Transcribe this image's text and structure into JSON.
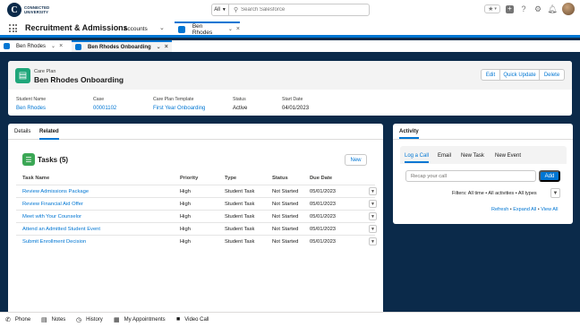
{
  "brand": {
    "logo_letter": "C",
    "name_line1": "CONNECTED",
    "name_line2": "UNIVERSITY"
  },
  "search": {
    "scope": "All",
    "placeholder": "Search Salesforce"
  },
  "app": {
    "name": "Recruitment & Admissions",
    "nav_item": "Accounts",
    "active_tab": "Ben Rhodes"
  },
  "subtabs": [
    {
      "label": "Ben Rhodes"
    },
    {
      "label": "Ben Rhodes Onboarding"
    }
  ],
  "record": {
    "type": "Care Plan",
    "name": "Ben Rhodes Onboarding",
    "buttons": {
      "edit": "Edit",
      "quick_update": "Quick Update",
      "delete": "Delete"
    },
    "fields": [
      {
        "label": "Student Name",
        "value": "Ben Rhodes"
      },
      {
        "label": "Case",
        "value": "00001102"
      },
      {
        "label": "Care Plan Template",
        "value": "First Year Onboarding"
      },
      {
        "label": "Status",
        "value": "Active"
      },
      {
        "label": "Start Date",
        "value": "04/01/2023"
      }
    ]
  },
  "main": {
    "tabs": [
      "Details",
      "Related"
    ],
    "tasks": {
      "title": "Tasks (5)",
      "new_button": "New",
      "columns": [
        "Task Name",
        "Priority",
        "Type",
        "Status",
        "Due Date"
      ],
      "rows": [
        {
          "name": "Review Admissions Package",
          "priority": "High",
          "type": "Student Task",
          "status": "Not Started",
          "due": "05/01/2023"
        },
        {
          "name": "Review Financial Aid Offer",
          "priority": "High",
          "type": "Student Task",
          "status": "Not Started",
          "due": "05/01/2023"
        },
        {
          "name": "Meet with Your Counselor",
          "priority": "High",
          "type": "Student Task",
          "status": "Not Started",
          "due": "05/01/2023"
        },
        {
          "name": "Attend an Admitted Student Event",
          "priority": "High",
          "type": "Student Task",
          "status": "Not Started",
          "due": "05/01/2023"
        },
        {
          "name": "Submit Enrollment Decision",
          "priority": "High",
          "type": "Student Task",
          "status": "Not Started",
          "due": "05/01/2023"
        }
      ]
    }
  },
  "activity": {
    "tab": "Activity",
    "subtabs": [
      "Log a Call",
      "Email",
      "New Task",
      "New Event"
    ],
    "recap_placeholder": "Recap your call",
    "add_button": "Add",
    "filters_text": "Filters: All time • All activities • All types",
    "refresh": "Refresh",
    "expand_all": "Expand All",
    "view_all": "View All",
    "separator": "•"
  },
  "footer": [
    "Phone",
    "Notes",
    "History",
    "My Appointments",
    "Video Call"
  ],
  "colors": {
    "brand_blue": "#0176d3",
    "navy": "#0b2a4a",
    "care_plan_green": "#1fa67a",
    "tasks_green": "#3ba755"
  }
}
